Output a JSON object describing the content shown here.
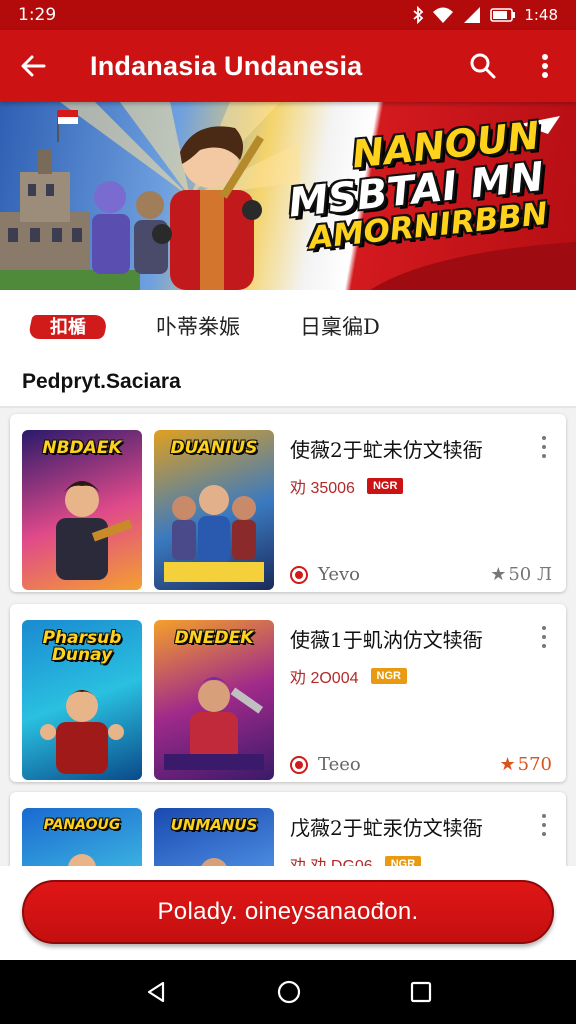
{
  "status_bar": {
    "time": "1:29",
    "right_text": "1:48",
    "icons": [
      "bluetooth-icon",
      "wifi-icon",
      "signal-icon",
      "battery-icon"
    ]
  },
  "app_bar": {
    "title": "Indanasia Undanesia",
    "icons": [
      "back-arrow-icon",
      "search-icon",
      "more-vert-icon"
    ],
    "color": "#cc1212"
  },
  "banner": {
    "line1": "NANOUN",
    "line2": "MSBTAI MN",
    "line3": "AMORNIRBBN"
  },
  "tabs": {
    "active_logo": "扣楯",
    "items": [
      "卟蒂桊娠",
      "日稟徧D"
    ]
  },
  "section": {
    "title": "Pedpryt.Saciara"
  },
  "cards": [
    {
      "thumb_a_title": "NBDAEK",
      "thumb_b_title": "DUANIUS",
      "title": "使薇2于虻未仿文犊衙",
      "price": "劝 35006",
      "badge": "NGR",
      "badge_color": "#cc1212",
      "developer": "Yevo",
      "rating": "50 Л",
      "rating_color": "#777777"
    },
    {
      "thumb_a_title": "Pharsub Dunay",
      "thumb_b_title": "DNEDEK",
      "title": "使薇1于虮汭仿文犊衙",
      "price": "劝 2O004",
      "badge": "NGR",
      "badge_color": "#e89a12",
      "developer": "Teeo",
      "rating": "570",
      "rating_color": "#d9531e"
    },
    {
      "thumb_a_title": "PANAOUG",
      "thumb_b_title": "UNMANUS",
      "title": "戊薇2于虻汞仿文犊衙",
      "price": "劝 劝 DG06",
      "badge": "NGR",
      "badge_color": "#e89a12",
      "developer": "",
      "rating": "",
      "rating_color": "#777777"
    }
  ],
  "cta": {
    "label": "Polady. oineysanaođon."
  },
  "nav_bar": {
    "icons": [
      "back-triangle-icon",
      "home-circle-icon",
      "recents-square-icon"
    ]
  }
}
